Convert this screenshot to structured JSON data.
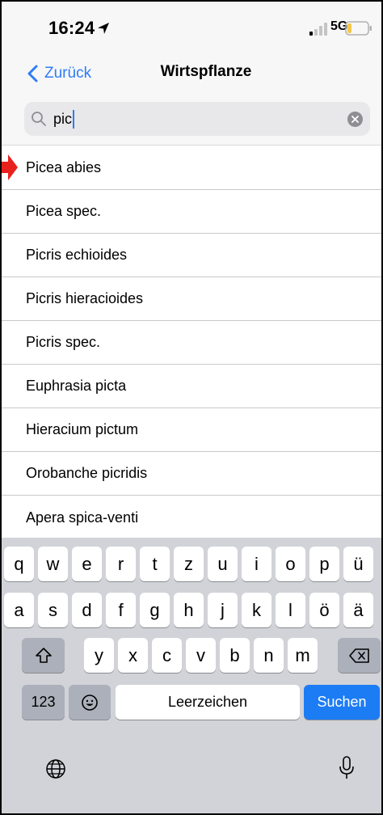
{
  "status_bar": {
    "time": "16:24",
    "network": "5G",
    "location_icon": "location-arrow-icon",
    "signal_icon": "cellular-signal-icon",
    "battery_icon": "battery-low-icon",
    "battery_color": "#f2c94c"
  },
  "nav": {
    "back_label": "Zurück",
    "title": "Wirtspflanze",
    "accent_color": "#2f7cf6"
  },
  "search": {
    "value": "pic",
    "icon": "search-icon",
    "clear_icon": "clear-icon"
  },
  "results": [
    "Picea abies",
    "Picea spec.",
    "Picris echioides",
    "Picris hieracioides",
    "Picris spec.",
    "Euphrasia picta",
    "Hieracium pictum",
    "Orobanche picridis",
    "Apera spica-venti"
  ],
  "annotation": {
    "icon": "red-arrow-icon",
    "color": "#e8211c",
    "points_to_index": 0
  },
  "keyboard": {
    "row1": [
      "q",
      "w",
      "e",
      "r",
      "t",
      "z",
      "u",
      "i",
      "o",
      "p",
      "ü"
    ],
    "row2": [
      "a",
      "s",
      "d",
      "f",
      "g",
      "h",
      "j",
      "k",
      "l",
      "ö",
      "ä"
    ],
    "row3": [
      "y",
      "x",
      "c",
      "v",
      "b",
      "n",
      "m"
    ],
    "numbers_label": "123",
    "space_label": "Leerzeichen",
    "search_label": "Suchen",
    "shift_icon": "shift-icon",
    "delete_icon": "delete-icon",
    "emoji_icon": "emoji-icon",
    "globe_icon": "globe-icon",
    "mic_icon": "microphone-icon"
  }
}
